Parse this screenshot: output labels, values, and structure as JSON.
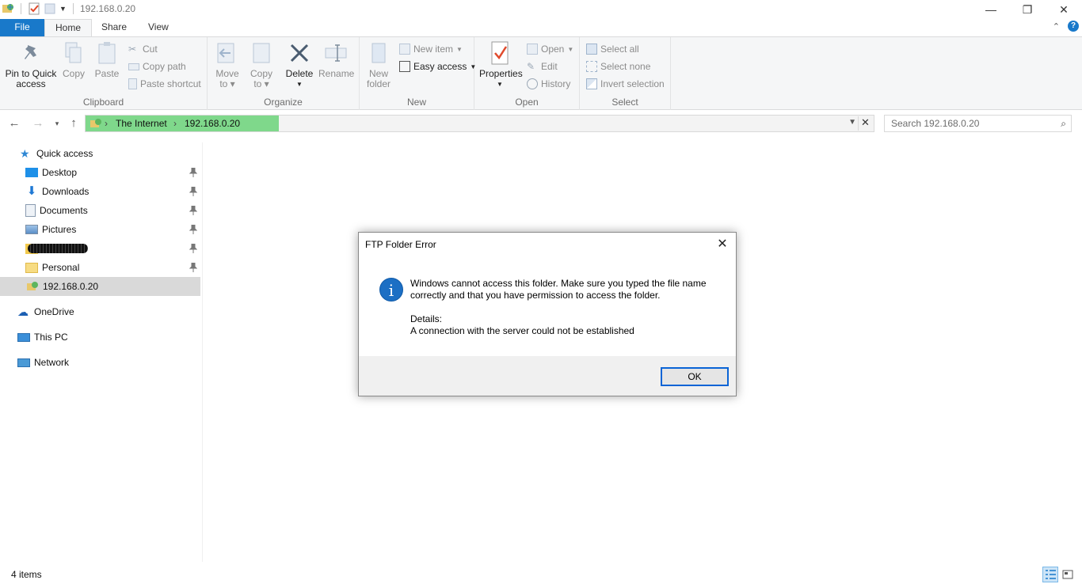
{
  "window": {
    "title": "192.168.0.20"
  },
  "window_controls": {
    "minimize": "—",
    "restore": "❐",
    "close": "✕"
  },
  "tabs": {
    "file": "File",
    "home": "Home",
    "share": "Share",
    "view": "View"
  },
  "ribbon": {
    "clipboard": {
      "label": "Clipboard",
      "pin_line1": "Pin to Quick",
      "pin_line2": "access",
      "copy": "Copy",
      "paste": "Paste",
      "cut": "Cut",
      "copy_path": "Copy path",
      "paste_shortcut": "Paste shortcut"
    },
    "organize": {
      "label": "Organize",
      "move_line1": "Move",
      "move_line2": "to",
      "copy_line1": "Copy",
      "copy_line2": "to",
      "delete": "Delete",
      "rename": "Rename"
    },
    "new": {
      "label": "New",
      "new_folder_line1": "New",
      "new_folder_line2": "folder",
      "new_item": "New item",
      "easy_access": "Easy access"
    },
    "open": {
      "label": "Open",
      "properties": "Properties",
      "open": "Open",
      "edit": "Edit",
      "history": "History"
    },
    "select": {
      "label": "Select",
      "select_all": "Select all",
      "select_none": "Select none",
      "invert_selection": "Invert selection"
    }
  },
  "address": {
    "crumbs": [
      "The Internet",
      "192.168.0.20"
    ],
    "separator": "›",
    "search_placeholder": "Search 192.168.0.20"
  },
  "nav": {
    "quick_access": "Quick access",
    "items": [
      "Desktop",
      "Downloads",
      "Documents",
      "Pictures",
      "",
      "Personal",
      "192.168.0.20"
    ],
    "onedrive": "OneDrive",
    "this_pc": "This PC",
    "network": "Network"
  },
  "dialog": {
    "title": "FTP Folder Error",
    "close": "✕",
    "icon": "i",
    "message": "Windows cannot access this folder. Make sure you typed the file name correctly and that you have permission to access the folder.",
    "details_label": "Details:",
    "details_text": "A connection with the server could not be established",
    "ok": "OK"
  },
  "status": {
    "item_count": "4 items"
  },
  "colors": {
    "accent": "#1979ca",
    "breadcrumb_highlight": "#7fd88b",
    "info_icon": "#1c6fc4"
  }
}
